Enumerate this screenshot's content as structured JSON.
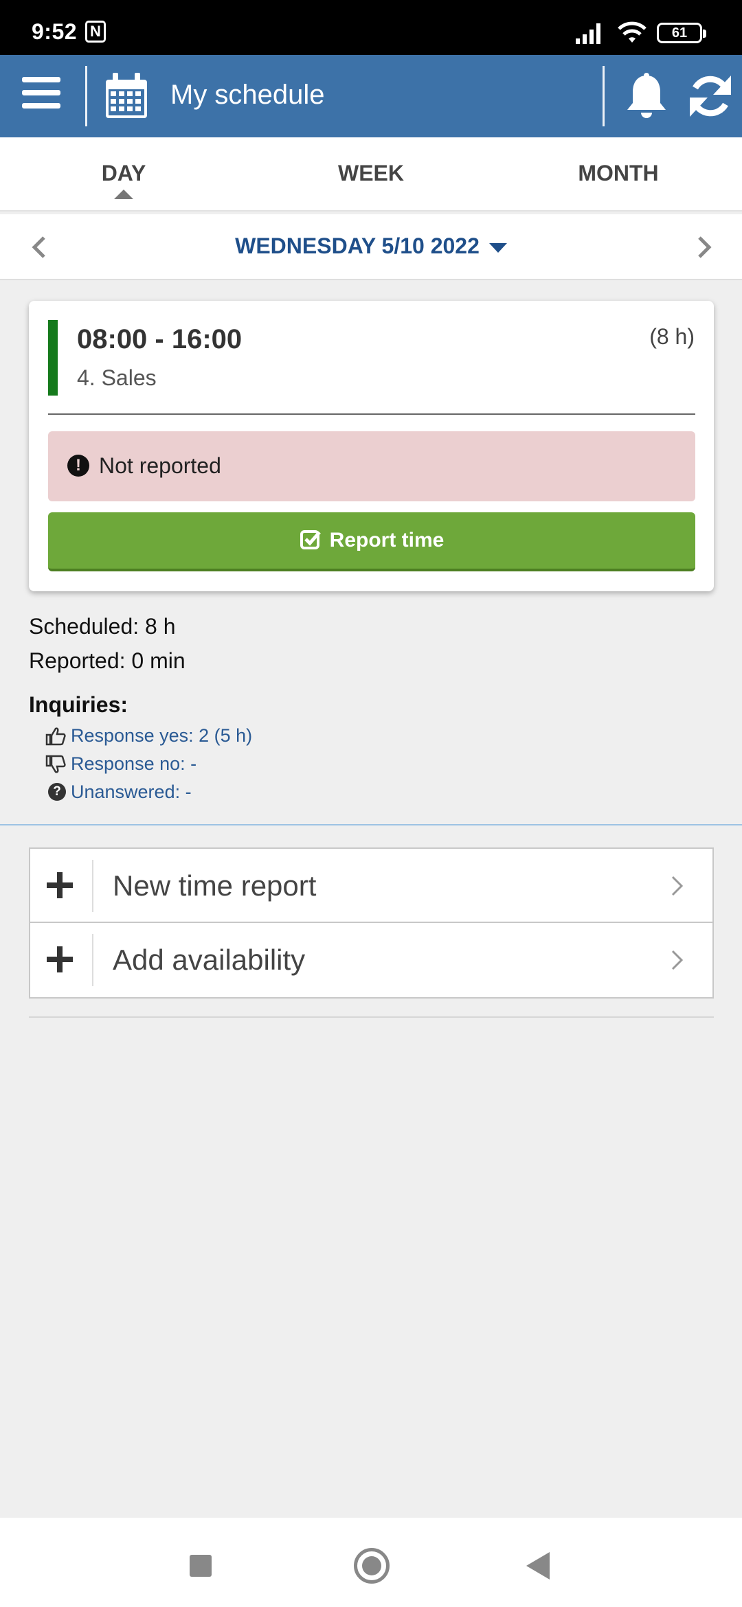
{
  "status_bar": {
    "time": "9:52",
    "nfc_label": "N",
    "battery": "61"
  },
  "header": {
    "title": "My schedule",
    "menu_icon": "hamburger-menu-icon",
    "calendar_icon": "calendar-icon",
    "bell_icon": "bell-icon",
    "refresh_icon": "refresh-icon",
    "background_color": "#3d72a8"
  },
  "tabs": [
    {
      "label": "DAY",
      "active": true
    },
    {
      "label": "WEEK",
      "active": false
    },
    {
      "label": "MONTH",
      "active": false
    }
  ],
  "date_nav": {
    "date_label": "WEDNESDAY 5/10 2022"
  },
  "shift": {
    "time_range": "08:00 - 16:00",
    "duration": "(8 h)",
    "department": "4. Sales",
    "bar_color": "#157a1c",
    "status_text": "Not reported",
    "status_bg": "#ebcfd0",
    "report_button_label": "Report time",
    "button_color": "#6ea83a"
  },
  "summary": {
    "scheduled": "Scheduled: 8 h",
    "reported": "Reported: 0 min"
  },
  "inquiries": {
    "title": "Inquiries:",
    "items": [
      {
        "icon": "thumbs-up-icon",
        "text": "Response yes: 2 (5 h)"
      },
      {
        "icon": "thumbs-down-icon",
        "text": "Response no: -"
      },
      {
        "icon": "question-circle-icon",
        "text": "Unanswered: -"
      }
    ]
  },
  "actions": [
    {
      "icon": "plus-icon",
      "label": "New time report"
    },
    {
      "icon": "plus-icon",
      "label": "Add availability"
    }
  ]
}
